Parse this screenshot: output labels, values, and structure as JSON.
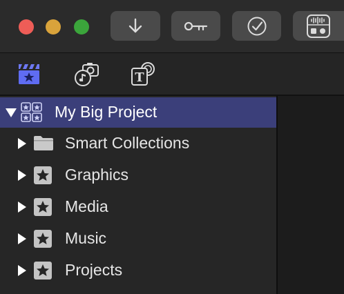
{
  "window": {
    "controls": [
      "close",
      "minimize",
      "zoom"
    ]
  },
  "toolbar": {
    "buttons": [
      {
        "name": "import",
        "icon": "download-arrow-icon"
      },
      {
        "name": "keywords",
        "icon": "key-icon"
      },
      {
        "name": "background-tasks",
        "icon": "checkmark-circle-icon"
      },
      {
        "name": "audio-tools",
        "icon": "waveform-icon"
      }
    ]
  },
  "tabs": [
    {
      "name": "libraries",
      "icon": "clapper-star-icon",
      "active": true
    },
    {
      "name": "photos-and-audio",
      "icon": "camera-music-icon",
      "active": false
    },
    {
      "name": "titles-and-generators",
      "icon": "title-t-icon",
      "active": false
    }
  ],
  "sidebar": {
    "library": {
      "label": "My Big Project",
      "expanded": true,
      "selected": true
    },
    "items": [
      {
        "label": "Smart Collections",
        "icon": "folder-icon"
      },
      {
        "label": "Graphics",
        "icon": "star-event-icon"
      },
      {
        "label": "Media",
        "icon": "star-event-icon"
      },
      {
        "label": "Music",
        "icon": "star-event-icon"
      },
      {
        "label": "Projects",
        "icon": "star-event-icon"
      }
    ]
  },
  "colors": {
    "selection": "#3b3f7a",
    "accent_blue": "#5f6cf2",
    "close": "#ee5d57",
    "minimize": "#d9a33b",
    "zoom": "#3ba53b"
  }
}
